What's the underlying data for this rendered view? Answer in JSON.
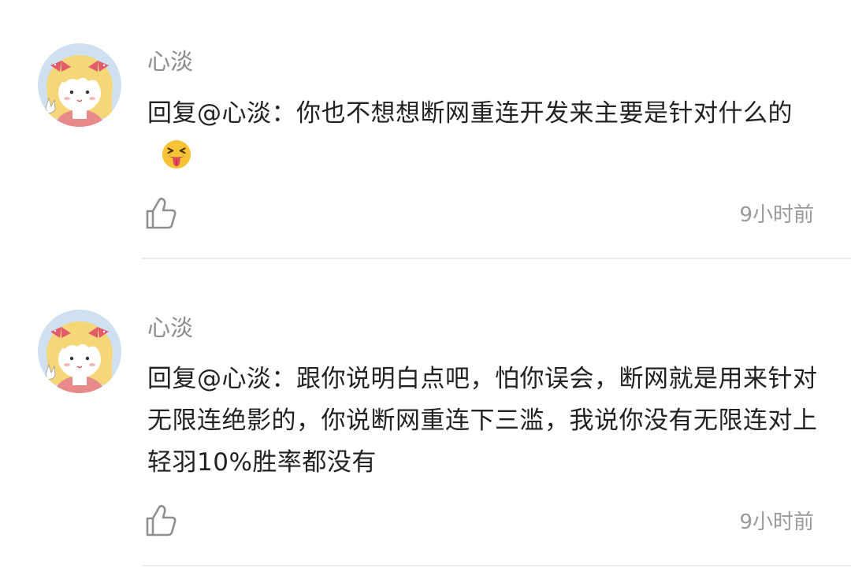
{
  "comments": [
    {
      "username": "心淡",
      "text": "回复@心淡：你也不想想断网重连开发来主要是针对什么的",
      "emoji": "squinting-tongue-face",
      "time": "9小时前"
    },
    {
      "username": "心淡",
      "text": "回复@心淡：跟你说明白点吧，怕你误会，断网就是用来针对无限连绝影的，你说断网重连下三滥，我说你没有无限连对上轻羽10%胜率都没有",
      "time": "9小时前"
    }
  ],
  "colors": {
    "avatar_bg": "#cfe0f0",
    "hair": "#f5d77a",
    "bow": "#e35b6b",
    "username": "#8c8c8c",
    "text": "#222222",
    "time": "#9a9a9a"
  }
}
